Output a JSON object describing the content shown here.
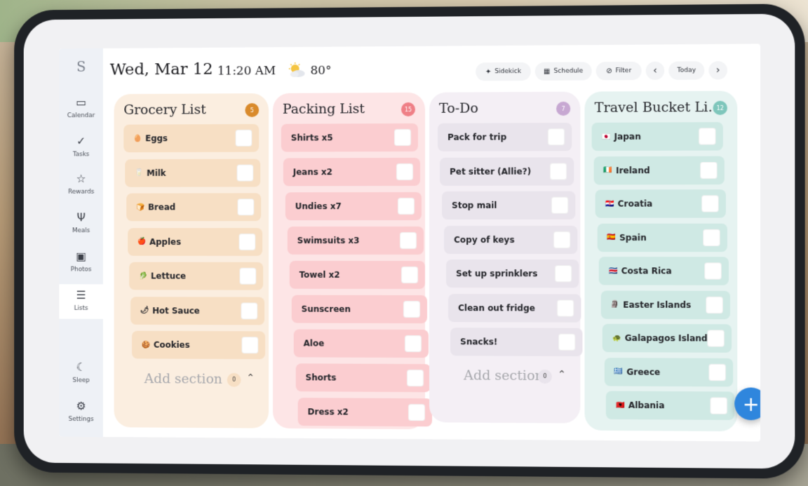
{
  "app": {
    "logo": "S"
  },
  "sidebar": {
    "items": [
      {
        "label": "Calendar",
        "icon": "calendar-icon",
        "glyph": "▭"
      },
      {
        "label": "Tasks",
        "icon": "check-icon",
        "glyph": "✓"
      },
      {
        "label": "Rewards",
        "icon": "star-icon",
        "glyph": "☆"
      },
      {
        "label": "Meals",
        "icon": "utensils-icon",
        "glyph": "Ψ"
      },
      {
        "label": "Photos",
        "icon": "photo-icon",
        "glyph": "▣"
      },
      {
        "label": "Lists",
        "icon": "list-icon",
        "glyph": "☰"
      },
      {
        "label": "Sleep",
        "icon": "moon-icon",
        "glyph": "☾"
      },
      {
        "label": "Settings",
        "icon": "gear-icon",
        "glyph": "⚙"
      }
    ],
    "active": "Lists"
  },
  "header": {
    "date": "Wed, Mar 12",
    "time": "11:20 AM",
    "weather_icon": "partly-sunny-icon",
    "temperature": "80°",
    "buttons": {
      "sidekick": "Sidekick",
      "schedule": "Schedule",
      "filter": "Filter",
      "prev": "‹",
      "today": "Today",
      "next": "›"
    }
  },
  "lists": [
    {
      "title": "Grocery List",
      "count": "5",
      "color": "#fbeee0",
      "item_color": "#f7dfc4",
      "badge_color": "#d98a2b",
      "items": [
        {
          "emoji": "🥚",
          "label": "Eggs"
        },
        {
          "emoji": "🥛",
          "label": "Milk"
        },
        {
          "emoji": "🍞",
          "label": "Bread"
        },
        {
          "emoji": "🍎",
          "label": "Apples"
        },
        {
          "emoji": "🥬",
          "label": "Lettuce"
        },
        {
          "emoji": "🌶",
          "label": "Hot Sauce"
        },
        {
          "emoji": "🍪",
          "label": "Cookies"
        }
      ],
      "add_section": "Add section",
      "add_count": "0"
    },
    {
      "title": "Packing List",
      "count": "15",
      "color": "#fde5e6",
      "item_color": "#fbcdd0",
      "badge_color": "#ef7f86",
      "items": [
        {
          "emoji": "",
          "label": "Shirts x5"
        },
        {
          "emoji": "",
          "label": "Jeans x2"
        },
        {
          "emoji": "",
          "label": "Undies x7"
        },
        {
          "emoji": "",
          "label": "Swimsuits x3"
        },
        {
          "emoji": "",
          "label": "Towel x2"
        },
        {
          "emoji": "",
          "label": "Sunscreen"
        },
        {
          "emoji": "",
          "label": "Aloe"
        },
        {
          "emoji": "",
          "label": "Shorts"
        },
        {
          "emoji": "",
          "label": "Dress x2"
        }
      ]
    },
    {
      "title": "To-Do",
      "count": "7",
      "color": "#f4eff5",
      "item_color": "#e9e4ec",
      "badge_color": "#c7a8d2",
      "items": [
        {
          "emoji": "",
          "label": "Pack for trip"
        },
        {
          "emoji": "",
          "label": "Pet sitter (Allie?)"
        },
        {
          "emoji": "",
          "label": "Stop mail"
        },
        {
          "emoji": "",
          "label": "Copy of keys"
        },
        {
          "emoji": "",
          "label": "Set up sprinklers"
        },
        {
          "emoji": "",
          "label": "Clean out fridge"
        },
        {
          "emoji": "",
          "label": "Snacks!"
        }
      ],
      "add_section": "Add section",
      "add_count": "0"
    },
    {
      "title": "Travel Bucket Li...",
      "count": "12",
      "color": "#e6f3f1",
      "item_color": "#cfe9e4",
      "badge_color": "#7ec6bb",
      "items": [
        {
          "emoji": "🇯🇵",
          "label": "Japan"
        },
        {
          "emoji": "🇮🇪",
          "label": "Ireland"
        },
        {
          "emoji": "🇭🇷",
          "label": "Croatia"
        },
        {
          "emoji": "🇪🇸",
          "label": "Spain"
        },
        {
          "emoji": "🇨🇷",
          "label": "Costa Rica"
        },
        {
          "emoji": "🗿",
          "label": "Easter Islands"
        },
        {
          "emoji": "🐢",
          "label": "Galapagos Islands"
        },
        {
          "emoji": "🇬🇷",
          "label": "Greece"
        },
        {
          "emoji": "🇦🇱",
          "label": "Albania"
        }
      ]
    }
  ],
  "fab": {
    "label": "+"
  }
}
